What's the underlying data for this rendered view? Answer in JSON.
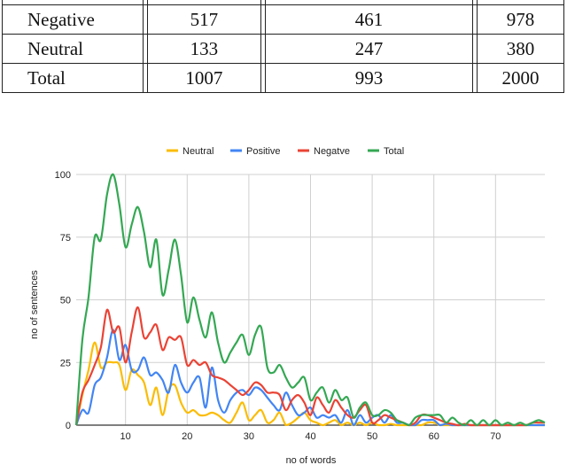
{
  "table": {
    "rows": [
      {
        "label": "",
        "c1": "",
        "c2": "",
        "c3": ""
      },
      {
        "label": "Negative",
        "c1": "517",
        "c2": "461",
        "c3": "978"
      },
      {
        "label": "Neutral",
        "c1": "133",
        "c2": "247",
        "c3": "380"
      },
      {
        "label": "Total",
        "c1": "1007",
        "c2": "993",
        "c3": "2000"
      }
    ]
  },
  "chart_data": {
    "type": "line",
    "title": "",
    "xlabel": "no of words",
    "ylabel": "no of sentences",
    "xlim": [
      2,
      78
    ],
    "ylim": [
      0,
      100
    ],
    "xticks": [
      10,
      20,
      30,
      40,
      50,
      60,
      70
    ],
    "yticks": [
      0,
      25,
      50,
      75,
      100
    ],
    "grid": true,
    "legend_position": "top",
    "x": [
      2,
      3,
      4,
      5,
      6,
      7,
      8,
      9,
      10,
      11,
      12,
      13,
      14,
      15,
      16,
      17,
      18,
      19,
      20,
      21,
      22,
      23,
      24,
      25,
      26,
      27,
      28,
      29,
      30,
      31,
      32,
      33,
      34,
      35,
      36,
      37,
      38,
      39,
      40,
      41,
      42,
      43,
      44,
      45,
      46,
      47,
      48,
      49,
      50,
      51,
      52,
      53,
      54,
      55,
      56,
      57,
      58,
      59,
      60,
      61,
      62,
      63,
      64,
      65,
      66,
      67,
      68,
      69,
      70,
      71,
      72,
      73,
      74,
      75,
      76,
      77,
      78
    ],
    "series": [
      {
        "name": "Neutral",
        "color": "#fbbc04",
        "values": [
          0,
          12,
          22,
          33,
          23,
          25,
          25,
          24,
          14,
          22,
          20,
          17,
          8,
          15,
          4,
          14,
          16,
          9,
          5,
          6,
          4,
          4,
          5,
          4,
          2,
          1,
          5,
          9,
          2,
          4,
          6,
          1,
          2,
          5,
          0,
          1,
          3,
          5,
          2,
          1,
          0,
          1,
          2,
          0,
          1,
          0,
          1,
          0,
          1,
          0,
          0,
          0.5,
          0,
          0,
          0,
          0,
          0,
          1,
          1,
          0,
          0,
          0,
          0,
          0,
          0,
          0,
          0,
          0,
          0,
          0,
          0,
          0,
          0,
          0,
          0,
          0,
          0
        ]
      },
      {
        "name": "Positive",
        "color": "#4285f4",
        "values": [
          0,
          6,
          5,
          16,
          19,
          27,
          38,
          26,
          32,
          22,
          22,
          27,
          20,
          21,
          18,
          13,
          24,
          17,
          13,
          17,
          19,
          7,
          23,
          10,
          5,
          10,
          13,
          14,
          12,
          15,
          14,
          11,
          8,
          6,
          13,
          8,
          4,
          5,
          7,
          3,
          4,
          3,
          4,
          1,
          6,
          0,
          4,
          1,
          3,
          4,
          1,
          4,
          1,
          1,
          0,
          0,
          2,
          2,
          2,
          0,
          0.5,
          0,
          0,
          0,
          0,
          0,
          0,
          0,
          0,
          0,
          0,
          0,
          0,
          0,
          0,
          0,
          0
        ]
      },
      {
        "name": "Negatve",
        "color": "#ea4335",
        "values": [
          0,
          13,
          18,
          24,
          31,
          46,
          37,
          39,
          25,
          37,
          47,
          35,
          37,
          40,
          30,
          35,
          34,
          35,
          24,
          26,
          24,
          25,
          20,
          19,
          18,
          16,
          14,
          12,
          14,
          17,
          16,
          13,
          13,
          12,
          6,
          10,
          12,
          9,
          4,
          11,
          8,
          5,
          10,
          7,
          4,
          3,
          6,
          8,
          1,
          2,
          4,
          3,
          2,
          1,
          0,
          1,
          4,
          4,
          3,
          2,
          1,
          0.5,
          0,
          0.5,
          0,
          0,
          0,
          0,
          0,
          0,
          0,
          0,
          0,
          0,
          1,
          1,
          1
        ]
      },
      {
        "name": "Total",
        "color": "#34a853",
        "values": [
          0,
          34,
          51,
          75,
          74,
          92,
          100,
          88,
          71,
          80,
          87,
          77,
          63,
          74,
          52,
          62,
          74,
          60,
          41,
          51,
          42,
          35,
          45,
          33,
          25,
          29,
          33,
          36,
          28,
          36,
          39,
          23,
          21,
          24,
          19,
          15,
          17,
          19,
          10,
          13,
          15,
          9,
          14,
          10,
          11,
          3,
          7,
          9,
          4,
          4,
          6,
          5,
          2,
          1,
          0,
          3,
          4,
          4,
          4,
          4,
          1,
          3,
          1,
          0,
          2,
          0,
          2,
          0,
          2,
          0,
          1,
          0,
          1,
          0,
          1,
          2,
          1
        ]
      }
    ]
  }
}
